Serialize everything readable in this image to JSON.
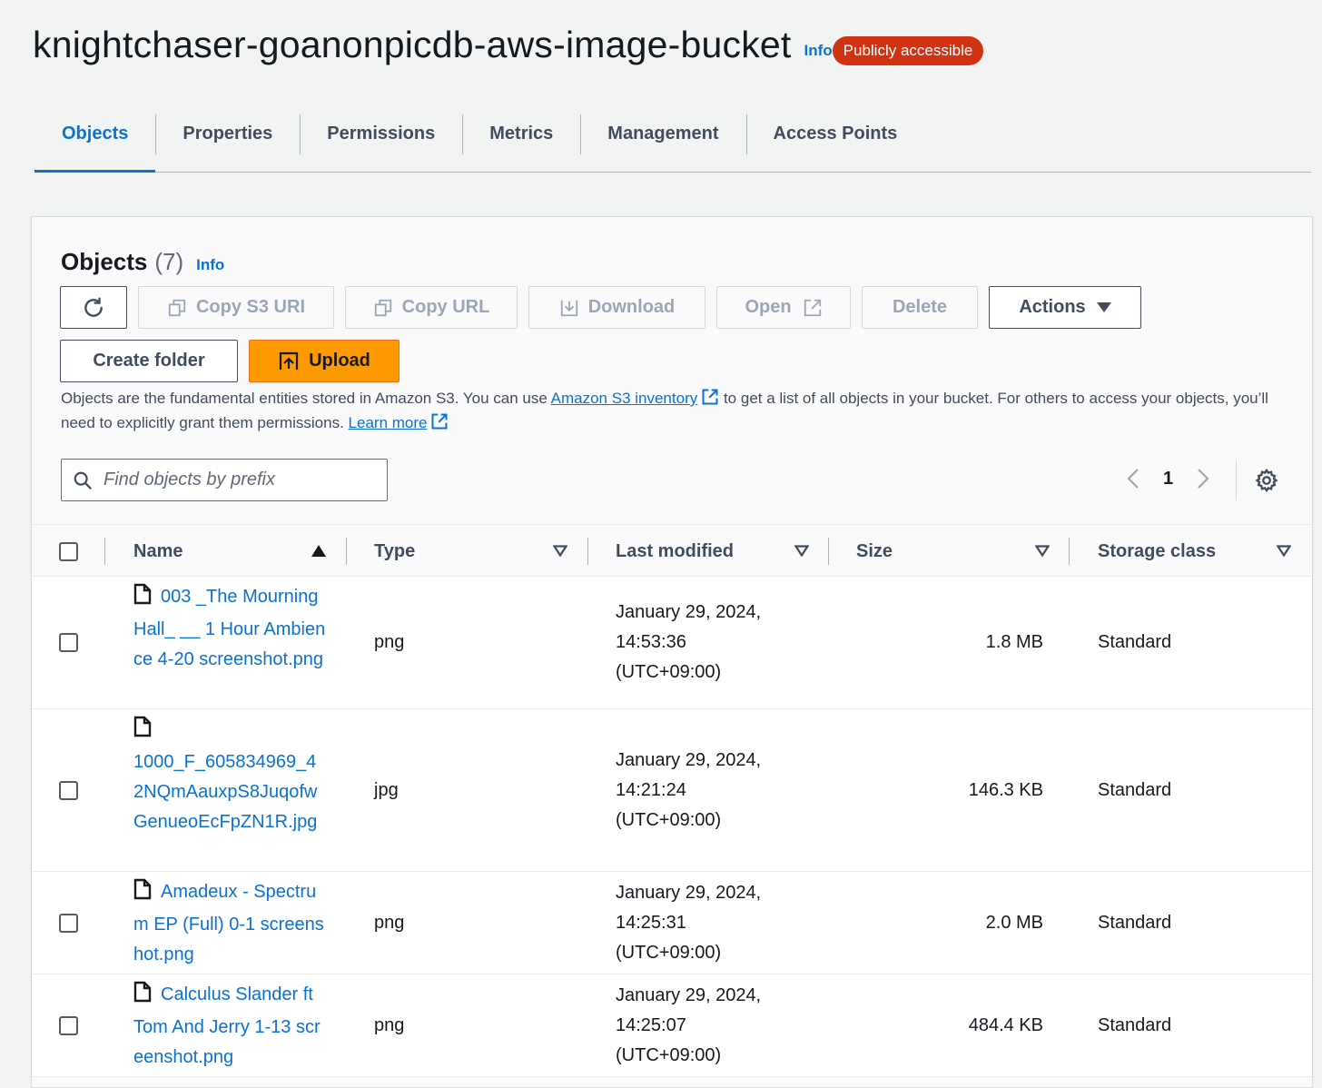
{
  "header": {
    "bucket_name": "knightchaser-goanonpicdb-aws-image-bucket",
    "info": "Info",
    "badge": "Publicly accessible",
    "badge_color": "#d13212"
  },
  "tabs": [
    {
      "label": "Objects",
      "active": true
    },
    {
      "label": "Properties"
    },
    {
      "label": "Permissions"
    },
    {
      "label": "Metrics"
    },
    {
      "label": "Management"
    },
    {
      "label": "Access Points"
    }
  ],
  "panel": {
    "title": "Objects",
    "count": "(7)",
    "info": "Info"
  },
  "toolbar": {
    "refresh_icon": "refresh-icon",
    "copy_s3_uri": "Copy S3 URI",
    "copy_url": "Copy URL",
    "download": "Download",
    "open": "Open",
    "delete": "Delete",
    "actions": "Actions",
    "create_folder": "Create folder",
    "upload": "Upload"
  },
  "description": {
    "part1": "Objects are the fundamental entities stored in Amazon S3. You can use ",
    "link1": "Amazon S3 inventory",
    "part2": " to get a list of all objects in your bucket. For others to access your objects, you’ll need to explicitly grant them permissions. ",
    "link2": "Learn more"
  },
  "search": {
    "placeholder": "Find objects by prefix"
  },
  "pagination": {
    "current_page": "1"
  },
  "table": {
    "columns": [
      "Name",
      "Type",
      "Last modified",
      "Size",
      "Storage class"
    ],
    "rows": [
      {
        "name": "003 _The Mourning Hall_ __ 1 Hour Ambience 4-20 screenshot.png",
        "type": "png",
        "modified_1": "January 29, 2024,",
        "modified_2": "14:53:36",
        "modified_3": "(UTC+09:00)",
        "size": "1.8 MB",
        "storage": "Standard"
      },
      {
        "name": "1000_F_605834969_42NQmAauxpS8JuqofwGenueoEcFpZN1R.jpg",
        "type": "jpg",
        "modified_1": "January 29, 2024,",
        "modified_2": "14:21:24",
        "modified_3": "(UTC+09:00)",
        "size": "146.3 KB",
        "storage": "Standard"
      },
      {
        "name": "Amadeux - Spectrum EP (Full) 0-1 screenshot.png",
        "type": "png",
        "modified_1": "January 29, 2024,",
        "modified_2": "14:25:31",
        "modified_3": "(UTC+09:00)",
        "size": "2.0 MB",
        "storage": "Standard"
      },
      {
        "name": "Calculus Slander ft Tom And Jerry 1-13 screenshot.png",
        "type": "png",
        "modified_1": "January 29, 2024,",
        "modified_2": "14:25:07",
        "modified_3": "(UTC+09:00)",
        "size": "484.4 KB",
        "storage": "Standard"
      }
    ]
  }
}
